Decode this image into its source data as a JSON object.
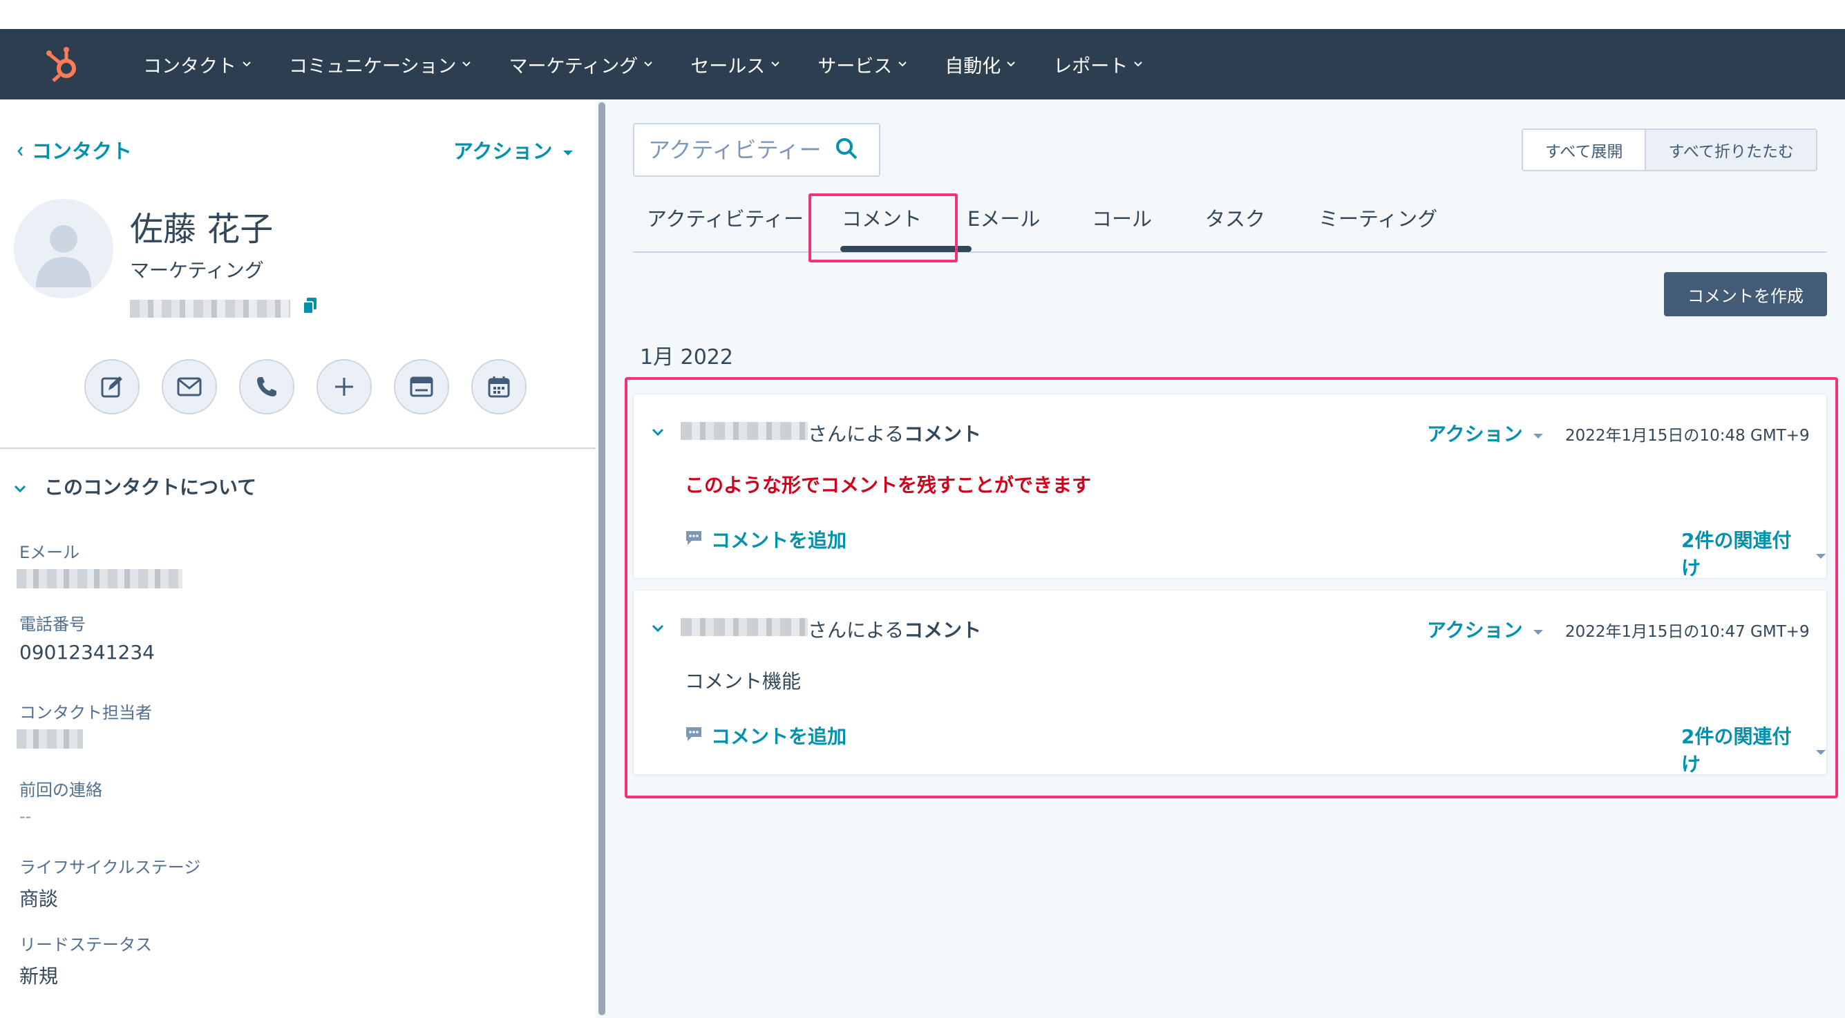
{
  "nav": {
    "items": [
      {
        "label": "コンタクト"
      },
      {
        "label": "コミュニケーション"
      },
      {
        "label": "マーケティング"
      },
      {
        "label": "セールス"
      },
      {
        "label": "サービス"
      },
      {
        "label": "自動化"
      },
      {
        "label": "レポート"
      }
    ]
  },
  "sidebar": {
    "back_label": "コンタクト",
    "actions_label": "アクション",
    "contact": {
      "name": "佐藤 花子",
      "role": "マーケティング"
    },
    "about_title": "このコンタクトについて",
    "properties": [
      {
        "label": "Eメール",
        "value": ""
      },
      {
        "label": "電話番号",
        "value": "09012341234"
      },
      {
        "label": "コンタクト担当者",
        "value": ""
      },
      {
        "label": "前回の連絡",
        "value": "--"
      },
      {
        "label": "ライフサイクルステージ",
        "value": "商談"
      },
      {
        "label": "リードステータス",
        "value": "新規"
      }
    ]
  },
  "main": {
    "search_placeholder": "アクティビティー",
    "expand_all": "すべて展開",
    "collapse_all": "すべて折りたたむ",
    "tabs": [
      {
        "label": "アクティビティー"
      },
      {
        "label": "コメント"
      },
      {
        "label": "Eメール"
      },
      {
        "label": "コール"
      },
      {
        "label": "タスク"
      },
      {
        "label": "ミーティング"
      }
    ],
    "active_tab": "コメント",
    "create_note": "コメントを作成",
    "month": "1月 2022",
    "notes": [
      {
        "by_suffix": "さんによる",
        "by_bold": "コメント",
        "action": "アクション",
        "time": "2022年1月15日の10:48 GMT+9",
        "body": "このような形でコメントを残すことができます",
        "add": "コメントを追加",
        "assoc": "2件の関連付け"
      },
      {
        "by_suffix": "さんによる",
        "by_bold": "コメント",
        "action": "アクション",
        "time": "2022年1月15日の10:47 GMT+9",
        "body": "コメント機能",
        "add": "コメントを追加",
        "assoc": "2件の関連付け"
      }
    ]
  },
  "colors": {
    "nav_bg": "#2d3e50",
    "link": "#0091ae",
    "highlight": "#f0337c",
    "alert_text": "#d0021b",
    "hubspot_orange": "#ff7a59"
  }
}
